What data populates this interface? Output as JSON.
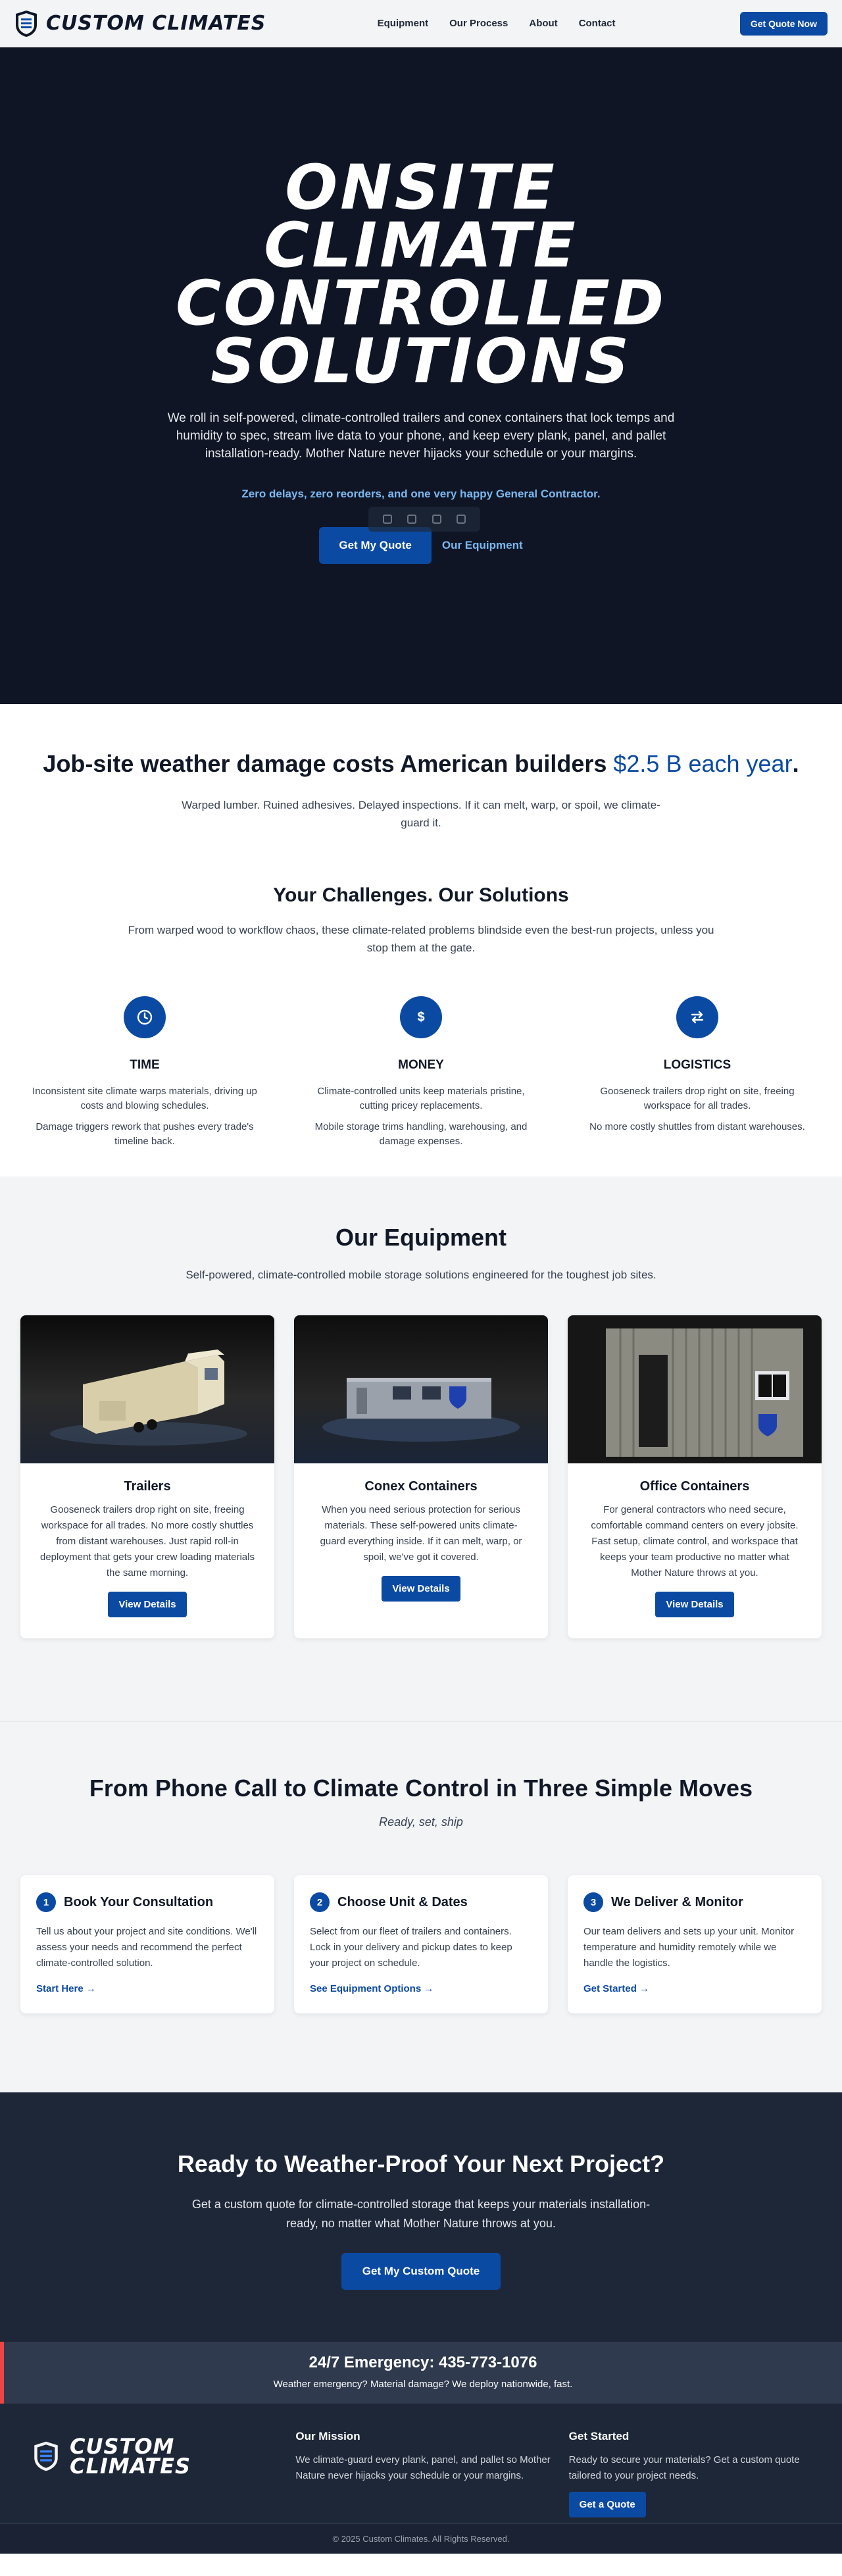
{
  "nav": {
    "brand": "CUSTOM CLIMATES",
    "links": [
      "Equipment",
      "Our Process",
      "About",
      "Contact"
    ],
    "cta": "Get Quote Now"
  },
  "hero": {
    "title_lines": [
      "ONSITE",
      "CLIMATE",
      "CONTROLLED",
      "SOLUTIONS"
    ],
    "subtitle": "We roll in self-powered, climate-controlled trailers and conex containers that lock temps and humidity to spec, stream live data to your phone, and keep every plank, panel, and pallet installation-ready. Mother Nature never hijacks your schedule or your margins.",
    "tagline": "Zero delays, zero reorders, and one very happy General Contractor.",
    "primary_button": "Get My Quote",
    "secondary_link": "Our Equipment"
  },
  "damage": {
    "headline_pre": "Job-site weather damage costs American builders ",
    "headline_highlight": "$2.5 B each year",
    "headline_post": ".",
    "lead": "Warped lumber. Ruined adhesives. Delayed inspections. If it can melt, warp, or spoil, we climate-guard it."
  },
  "challenges": {
    "title": "Your Challenges. Our Solutions",
    "subtitle": "From warped wood to workflow chaos, these climate-related problems blindside even the best-run projects, unless you stop them at the gate.",
    "items": [
      {
        "icon": "clock-icon",
        "title": "TIME",
        "problem": "Inconsistent site climate warps materials, driving up costs and blowing schedules.",
        "solution": "Damage triggers rework that pushes every trade's timeline back."
      },
      {
        "icon": "dollar-icon",
        "symbol": "$",
        "title": "MONEY",
        "problem": "Climate-controlled units keep materials pristine, cutting pricey replacements.",
        "solution": "Mobile storage trims handling, warehousing, and damage expenses."
      },
      {
        "icon": "swap-arrows-icon",
        "title": "LOGISTICS",
        "problem": "Gooseneck trailers drop right on site, freeing workspace for all trades.",
        "solution": "No more costly shuttles from distant warehouses."
      }
    ]
  },
  "equipment": {
    "title": "Our Equipment",
    "subtitle": "Self-powered, climate-controlled mobile storage solutions engineered for the toughest job sites.",
    "items": [
      {
        "title": "Trailers",
        "text": "Gooseneck trailers drop right on site, freeing workspace for all trades. No more costly shuttles from distant warehouses. Just rapid roll-in deployment that gets your crew loading materials the same morning.",
        "button": "View Details"
      },
      {
        "title": "Conex Containers",
        "text": "When you need serious protection for serious materials. These self-powered units climate-guard everything inside. If it can melt, warp, or spoil, we've got it covered.",
        "button": "View Details"
      },
      {
        "title": "Office Containers",
        "text": "For general contractors who need secure, comfortable command centers on every jobsite. Fast setup, climate control, and workspace that keeps your team productive no matter what Mother Nature throws at you.",
        "button": "View Details"
      }
    ]
  },
  "steps": {
    "title": "From Phone Call to Climate Control in Three Simple Moves",
    "subtitle": "Ready, set, ship",
    "items": [
      {
        "num": "1",
        "title": "Book Your Consultation",
        "text": "Tell us about your project and site conditions. We'll assess your needs and recommend the perfect climate-controlled solution.",
        "link": "Start Here →"
      },
      {
        "num": "2",
        "title": "Choose Unit & Dates",
        "text": "Select from our fleet of trailers and containers. Lock in your delivery and pickup dates to keep your project on schedule.",
        "link": "See Equipment Options →"
      },
      {
        "num": "3",
        "title": "We Deliver & Monitor",
        "text": "Our team delivers and sets up your unit. Monitor temperature and humidity remotely while we handle the logistics.",
        "link": "Get Started →"
      }
    ]
  },
  "cta": {
    "title": "Ready to Weather-Proof Your Next Project?",
    "text": "Get a custom quote for climate-controlled storage that keeps your materials installation-ready, no matter what Mother Nature throws at you.",
    "button": "Get My Custom Quote"
  },
  "emergency": {
    "title": "24/7 Emergency: 435-773-1076",
    "text": "Weather emergency? Material damage? We deploy nationwide, fast."
  },
  "footer": {
    "brand_line1": "CUSTOM",
    "brand_line2": "CLIMATES",
    "mission_title": "Our Mission",
    "mission_text": "We climate-guard every plank, panel, and pallet so Mother Nature never hijacks your schedule or your margins.",
    "start_title": "Get Started",
    "start_text": "Ready to secure your materials? Get a custom quote tailored to your project needs.",
    "start_button": "Get a Quote",
    "copyright": "© 2025 Custom Climates. All Rights Reserved."
  },
  "colors": {
    "brand_blue": "#0b4aa2",
    "dark_navy": "#0f1524",
    "slate": "#1e2738",
    "accent_light_blue": "#7ab8f0",
    "emergency_red": "#ef4444"
  }
}
